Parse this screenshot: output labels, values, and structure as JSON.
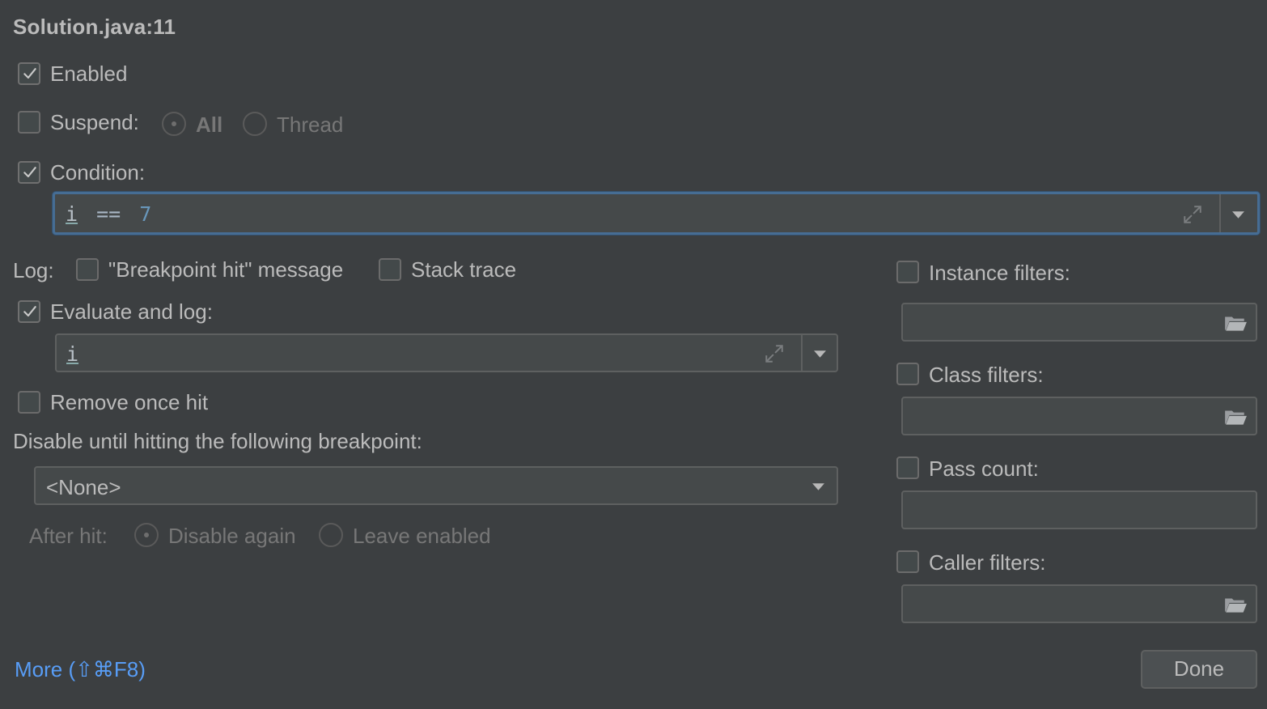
{
  "dialog": {
    "title": "Solution.java:11"
  },
  "enabled": {
    "label": "Enabled",
    "checked": true
  },
  "suspend": {
    "label": "Suspend:",
    "checked": false,
    "options": [
      "All",
      "Thread"
    ],
    "selected": "All"
  },
  "condition": {
    "label": "Condition:",
    "checked": true,
    "value_ident": "i",
    "value_op": "==",
    "value_num": "7"
  },
  "log": {
    "label": "Log:",
    "breakpoint_hit": {
      "label": "\"Breakpoint hit\" message",
      "checked": false
    },
    "stack_trace": {
      "label": "Stack trace",
      "checked": false
    }
  },
  "evaluate": {
    "label": "Evaluate and log:",
    "checked": true,
    "value": "i"
  },
  "remove_once_hit": {
    "label": "Remove once hit",
    "checked": false
  },
  "disable_until": {
    "label": "Disable until hitting the following breakpoint:",
    "selected": "<None>"
  },
  "after_hit": {
    "label": "After hit:",
    "options": [
      "Disable again",
      "Leave enabled"
    ],
    "selected": "Disable again"
  },
  "filters": {
    "instance": {
      "label": "Instance filters:",
      "checked": false,
      "value": ""
    },
    "class": {
      "label": "Class filters:",
      "checked": false,
      "value": ""
    },
    "pass_count": {
      "label": "Pass count:",
      "checked": false,
      "value": ""
    },
    "caller": {
      "label": "Caller filters:",
      "checked": false,
      "value": ""
    }
  },
  "footer": {
    "more_link": "More (⇧⌘F8)",
    "done_label": "Done"
  },
  "colors": {
    "background": "#3c3f41",
    "focus_border": "#466d94",
    "link": "#589df6"
  }
}
